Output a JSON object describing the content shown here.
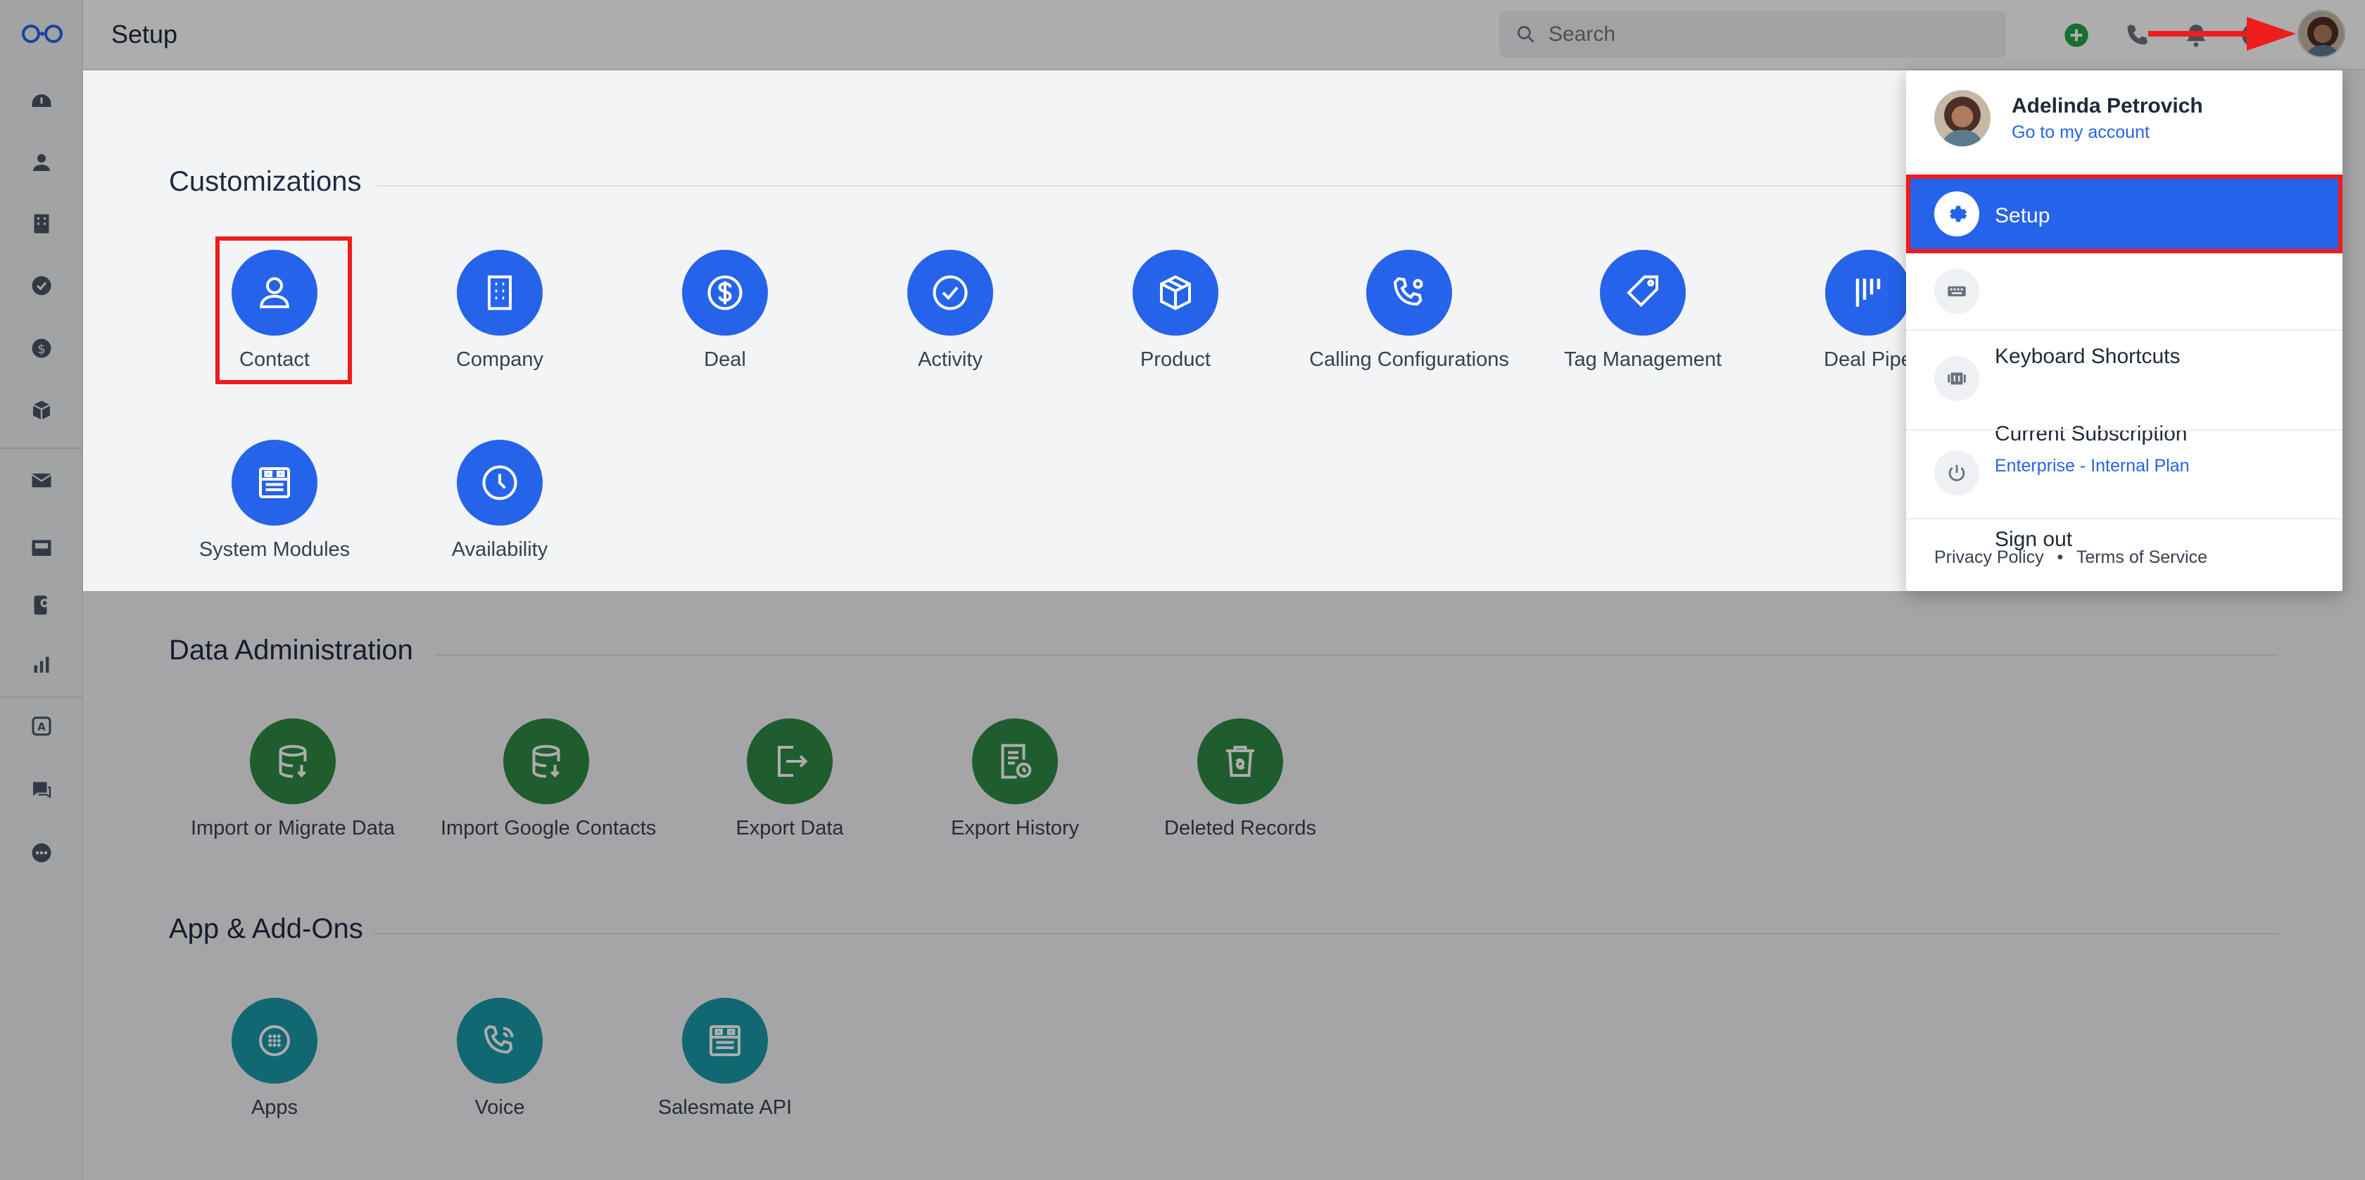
{
  "header": {
    "title": "Setup",
    "search_placeholder": "Search"
  },
  "sections": [
    {
      "title": "Customizations",
      "items": [
        {
          "label": "Contact",
          "icon": "user-icon"
        },
        {
          "label": "Company",
          "icon": "building-icon"
        },
        {
          "label": "Deal",
          "icon": "dollar-icon"
        },
        {
          "label": "Activity",
          "icon": "check-circle-icon"
        },
        {
          "label": "Product",
          "icon": "box-icon"
        },
        {
          "label": "Calling Configurations",
          "icon": "phone-gear-icon"
        },
        {
          "label": "Tag Management",
          "icon": "tag-icon"
        },
        {
          "label": "Deal Pipe",
          "icon": "pipeline-icon"
        },
        {
          "label": "System Modules",
          "icon": "modules-icon"
        },
        {
          "label": "Availability",
          "icon": "clock-icon"
        }
      ]
    },
    {
      "title": "Data Administration",
      "items": [
        {
          "label": "Import or Migrate Data",
          "icon": "database-import-icon"
        },
        {
          "label": "Import Google Contacts",
          "icon": "database-import-icon"
        },
        {
          "label": "Export Data",
          "icon": "export-icon"
        },
        {
          "label": "Export History",
          "icon": "document-clock-icon"
        },
        {
          "label": "Deleted Records",
          "icon": "trash-restore-icon"
        }
      ]
    },
    {
      "title": "App & Add-Ons",
      "items": [
        {
          "label": "Apps",
          "icon": "apps-grid-icon"
        },
        {
          "label": "Voice",
          "icon": "phone-icon"
        },
        {
          "label": "Salesmate API",
          "icon": "api-icon"
        }
      ]
    }
  ],
  "account_menu": {
    "user_name": "Adelinda Petrovich",
    "account_link": "Go to my account",
    "items": [
      {
        "label": "Setup",
        "icon": "gear-icon"
      },
      {
        "label": "Keyboard Shortcuts",
        "icon": "keyboard-icon"
      },
      {
        "label": "Current Subscription",
        "sub": "Enterprise - Internal Plan",
        "icon": "subscription-icon"
      },
      {
        "label": "Sign out",
        "icon": "power-icon"
      }
    ],
    "footer": {
      "privacy": "Privacy Policy",
      "separator": "•",
      "terms": "Terms of Service"
    }
  },
  "colors": {
    "primary_blue": "#2563eb",
    "data_green": "#2f8a45",
    "addon_teal": "#1a9aa8",
    "annotation_red": "#ef1c1c"
  }
}
